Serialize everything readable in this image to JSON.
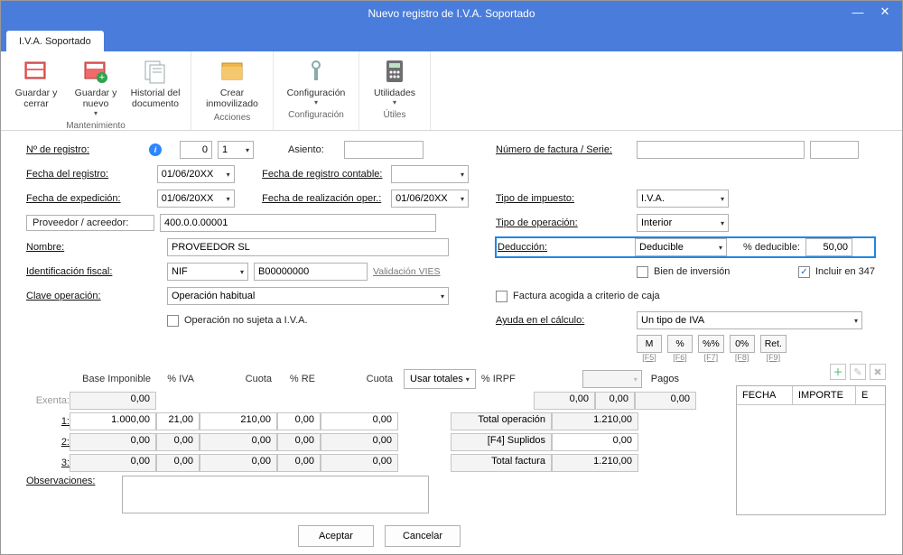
{
  "window": {
    "title": "Nuevo registro de I.V.A. Soportado"
  },
  "tab": {
    "label": "I.V.A. Soportado"
  },
  "ribbon": {
    "grp1": {
      "label": "Mantenimiento",
      "save_close": "Guardar y cerrar",
      "save_new": "Guardar y nuevo",
      "history": "Historial del documento"
    },
    "grp2": {
      "label": "Acciones",
      "create_fixed": "Crear inmovilizado"
    },
    "grp3": {
      "label": "Configuración",
      "config": "Configuración"
    },
    "grp4": {
      "label": "Útiles",
      "util": "Utilidades"
    }
  },
  "left": {
    "reg_no_label": "Nº de registro:",
    "reg_no_a": "0",
    "reg_no_b": "1",
    "date_reg_label": "Fecha del registro:",
    "date_reg": "01/06/20XX",
    "date_exp_label": "Fecha de expedición:",
    "date_exp": "01/06/20XX",
    "supplier_label": "Proveedor / acreedor:",
    "supplier_code": "400.0.0.00001",
    "name_label": "Nombre:",
    "name_val": "PROVEEDOR SL",
    "fiscal_label": "Identificación fiscal:",
    "fiscal_type": "NIF",
    "fiscal_no": "B00000000",
    "vies": "Validación VIES",
    "op_key_label": "Clave operación:",
    "op_key_val": "Operación habitual",
    "not_subject": "Operación no sujeta a I.V.A."
  },
  "mid": {
    "asiento_label": "Asiento:",
    "acc_date_label": "Fecha de registro contable:",
    "real_date_label": "Fecha de realización oper.:",
    "real_date": "01/06/20XX"
  },
  "right": {
    "invoice_label": "Número de factura / Serie:",
    "tax_type_label": "Tipo de impuesto:",
    "tax_type_val": "I.V.A.",
    "op_type_label": "Tipo de operación:",
    "op_type_val": "Interior",
    "deduction_label": "Deducción:",
    "deduction_val": "Deducible",
    "deduct_pct_label": "% deducible:",
    "deduct_pct_val": "50,00",
    "investment": "Bien de inversión",
    "include_347": "Incluir en 347",
    "cash_criteria": "Factura acogida a criterio de caja",
    "calc_help_label": "Ayuda en el cálculo:",
    "calc_help_val": "Un tipo de IVA",
    "calc_btns": {
      "m": "M",
      "pct": "%",
      "pctpct": "%%",
      "zero": "0%",
      "ret": "Ret."
    },
    "hints": {
      "f5": "[F5]",
      "f6": "[F6]",
      "f7": "[F7]",
      "f8": "[F8]",
      "f9": "[F9]"
    }
  },
  "grid": {
    "h_base": "Base Imponible",
    "h_iva": "% IVA",
    "h_cuota": "Cuota",
    "h_re": "% RE",
    "h_cuota2": "Cuota",
    "use_totals": "Usar totales",
    "h_irpf": "% IRPF",
    "exenta_lbl": "Exenta:",
    "exenta": "0,00",
    "r1_lbl": "1:",
    "r1": {
      "base": "1.000,00",
      "iva": "21,00",
      "cuota": "210,00",
      "re": "0,00",
      "cuota2": "0,00"
    },
    "r2_lbl": "2:",
    "r2": {
      "base": "0,00",
      "iva": "0,00",
      "cuota": "0,00",
      "re": "0,00",
      "cuota2": "0,00"
    },
    "r3_lbl": "3:",
    "r3": {
      "base": "0,00",
      "iva": "0,00",
      "cuota": "0,00",
      "re": "0,00",
      "cuota2": "0,00"
    },
    "irpf_base": "0,00",
    "irpf_pct": "0,00",
    "irpf_cuota": "0,00",
    "total_op_lbl": "Total operación",
    "total_op": "1.210,00",
    "suplidos_lbl": "[F4] Suplidos",
    "suplidos": "0,00",
    "total_fact_lbl": "Total factura",
    "total_fact": "1.210,00",
    "obs_label": "Observaciones:"
  },
  "payments": {
    "title": "Pagos",
    "col_date": "FECHA",
    "col_amount": "IMPORTE",
    "col_e": "E"
  },
  "buttons": {
    "ok": "Aceptar",
    "cancel": "Cancelar"
  }
}
